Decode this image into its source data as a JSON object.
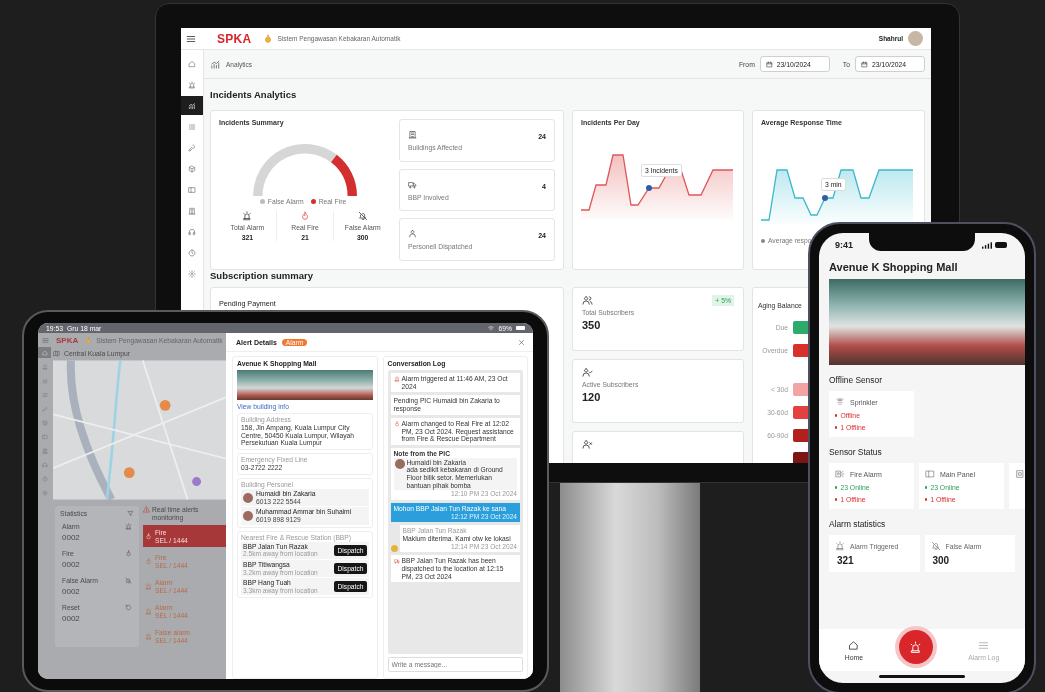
{
  "monitor": {
    "app_name": "SPKA",
    "system_name": "Sistem Pengawasan Kebakaran Automatik",
    "user": "Shahrul",
    "sidebar": [
      {
        "kind": "house",
        "selected": false
      },
      {
        "kind": "siren",
        "selected": false
      },
      {
        "kind": "chart",
        "selected": true
      },
      {
        "kind": "list",
        "selected": false
      },
      {
        "kind": "key",
        "selected": false
      },
      {
        "kind": "box",
        "selected": false
      },
      {
        "kind": "panel",
        "selected": false
      },
      {
        "kind": "building",
        "selected": false
      },
      {
        "kind": "headset",
        "selected": false
      },
      {
        "kind": "clock",
        "selected": false
      },
      {
        "kind": "gear",
        "selected": false
      }
    ],
    "page": "Analytics",
    "from_label": "From",
    "from_date": "23/10/2024",
    "to_label": "To",
    "to_date": "23/10/2024",
    "incidents_title": "Incidents Analytics",
    "incidents_summary": {
      "title": "Incidents Summary",
      "gauge": {
        "level": 0.25
      },
      "legend": [
        {
          "label": "False Alarm",
          "color": "#bdbdbd"
        },
        {
          "label": "Real Fire",
          "color": "#d32f2f"
        }
      ],
      "stats": [
        {
          "kind": "siren",
          "label": "Total Alarm",
          "value": "321"
        },
        {
          "kind": "flame",
          "label": "Real Fire",
          "value": "21"
        },
        {
          "kind": "bell-off",
          "label": "False Alarm",
          "value": "300"
        }
      ]
    },
    "stat_cards": [
      {
        "kind": "building",
        "label": "Buildings Affected",
        "value": "24"
      },
      {
        "kind": "truck",
        "label": "BBP Involved",
        "value": "4"
      },
      {
        "kind": "person",
        "label": "Personell Dispatched",
        "value": "24"
      }
    ],
    "incidents_per_day": {
      "title": "Incidents Per Day",
      "tooltip": "3 Incidents"
    },
    "response_time": {
      "title": "Average Response Time",
      "tooltip": "3 min",
      "legend": "Average respo"
    },
    "subscription_title": "Subscription summary",
    "pending_payment": {
      "title": "Pending Payment"
    },
    "subscribers": [
      {
        "kind": "users",
        "label": "Total Subscribers",
        "value": "350",
        "badge": "+ 5%"
      },
      {
        "kind": "user-check",
        "label": "Active Subscribers",
        "value": "120"
      },
      {
        "kind": "user-x"
      }
    ],
    "aging": {
      "title": "Aging Balance",
      "bars": [
        {
          "label": "Due",
          "color": "#2eaa6a"
        },
        {
          "label": "Overdue",
          "color": "#d9302c"
        },
        {
          "label": "< 30d",
          "color": "#f2a3a3"
        },
        {
          "label": "30-60d",
          "color": "#e2413f"
        },
        {
          "label": "60-90d",
          "color": "#b21f1f"
        },
        {
          "color": "#7d1515"
        }
      ]
    }
  },
  "tablet": {
    "time": "19:53",
    "date": "Gru 18 mar",
    "battery": "69%",
    "app_name": "SPKA",
    "system_name": "Sistem Pengawasan Kebakaran Automatik",
    "location": "Central Kuala Lumpur",
    "sidebar": [
      {
        "kind": "house",
        "selected": true
      },
      {
        "kind": "siren",
        "selected": false
      },
      {
        "kind": "chart",
        "selected": false
      },
      {
        "kind": "list",
        "selected": false
      },
      {
        "kind": "key",
        "selected": false
      },
      {
        "kind": "box",
        "selected": false
      },
      {
        "kind": "panel",
        "selected": false
      },
      {
        "kind": "building",
        "selected": false
      },
      {
        "kind": "headset",
        "selected": false
      },
      {
        "kind": "clock",
        "selected": false
      },
      {
        "kind": "gear",
        "selected": false
      }
    ],
    "statistics": {
      "title": "Statistics",
      "items": [
        {
          "kind": "siren",
          "label": "Alarm",
          "value": "0002"
        },
        {
          "kind": "flame",
          "label": "Fire",
          "value": "0002"
        },
        {
          "kind": "bell-off",
          "label": "False Alarm",
          "value": "0002"
        },
        {
          "kind": "reset",
          "label": "Reset",
          "value": "0002"
        }
      ]
    },
    "alerts": {
      "title": "Real time alerts monitoring",
      "rows": [
        {
          "kind": "flame",
          "type": "Fire",
          "code": "SEL / 1444",
          "selected": true
        },
        {
          "kind": "flame",
          "type": "Fire",
          "code": "SEL / 1444",
          "selected": false
        },
        {
          "kind": "siren",
          "type": "Alarm",
          "code": "SEL / 1444",
          "selected": false
        },
        {
          "kind": "siren",
          "type": "Alarm",
          "code": "SEL / 1444",
          "selected": false
        },
        {
          "kind": "siren",
          "type": "False alarm",
          "code": "SEL / 1444",
          "selected": false
        }
      ]
    },
    "alert_details": {
      "title": "Alert Details",
      "badge": "Alarm",
      "building": "Avenue K Shopping Mall",
      "link": "View building info",
      "address_label": "Building Address",
      "address": "158, Jln Ampang, Kuala Lumpur City Centre, 50450 Kuala Lumpur, Wilayah Persekutuan Kuala Lumpur",
      "phone_label": "Emergency Fixed Line",
      "phone": "03-2722 2222",
      "personnel_label": "Building Personel",
      "personnel": [
        {
          "name": "Humaidi bin Zakaria",
          "phone": "6013 222 5544"
        },
        {
          "name": "Muhammad Ammar bin Suhaimi",
          "phone": "6019 898 9129"
        }
      ],
      "stations_label": "Nearest Fire & Rescue Station (BBP)",
      "stations": [
        {
          "name": "BBP Jalan Tun Razak",
          "distance": "2.5km away from location",
          "action": "Dispatch"
        },
        {
          "name": "BBP Titiwangsa",
          "distance": "3.2km away from location",
          "action": "Dispatch"
        },
        {
          "name": "BBP Hang Tuah",
          "distance": "3.3km away from location",
          "action": "Dispatch"
        }
      ],
      "log_title": "Conversation Log",
      "log": [
        {
          "kind": "alarm-event",
          "text": "Alarm triggered at 11:46 AM, 23 Oct 2024"
        },
        {
          "kind": "event",
          "text": "Pending PIC Humaidi bin Zakaria to response"
        },
        {
          "kind": "fire-event",
          "text": "Alarm changed to Real Fire at 12:02 PM, 23 Oct 2024. Request assistance from Fire & Rescue Department"
        },
        {
          "kind": "note",
          "title": "Note from the PIC",
          "author": "Humaidi bin Zakaria",
          "text": "ada sedikit kebakaran di Ground Floor bilik setor. Memerlukan bantuan pihak bomba",
          "time": "12:10 PM 23 Oct 2024"
        },
        {
          "kind": "outgoing",
          "text": "Mohon BBP Jalan Tun Razak ke sana",
          "time": "12:12 PM 23 Oct 2024"
        },
        {
          "kind": "incoming",
          "author": "BBP Jalan Tun Razak",
          "text": "Maklum diterima. Kami otw ke lokasi",
          "time": "12:14 PM 23 Oct 2024"
        },
        {
          "kind": "dispatch-event",
          "text": "BBP Jalan Tun Razak has been dispatched to the location at 12:15 PM, 23 Oct 2024"
        }
      ],
      "message_placeholder": "Write a message..."
    }
  },
  "phone": {
    "time": "9:41",
    "title": "Avenue K Shopping Mall",
    "offline_title": "Offline Sensor",
    "offline": [
      {
        "kind": "sprinkler",
        "name": "Sprinkler",
        "lines": [
          {
            "text": "Offline",
            "online": false
          },
          {
            "text": "1 Offline",
            "online": false
          }
        ]
      }
    ],
    "status_title": "Sensor Status",
    "sensors": [
      {
        "kind": "fire-alarm",
        "name": "Fire Alarm",
        "lines": [
          {
            "text": "23 Online",
            "online": true
          },
          {
            "text": "1 Offline",
            "online": false
          }
        ]
      },
      {
        "kind": "panel",
        "name": "Main Panel",
        "lines": [
          {
            "text": "23 Online",
            "online": true
          },
          {
            "text": "1 Offline",
            "online": false
          }
        ]
      },
      {
        "kind": "device"
      }
    ],
    "stats_title": "Alarm statistics",
    "stats": [
      {
        "kind": "siren",
        "label": "Alarm Triggered",
        "value": "321"
      },
      {
        "kind": "bell-off",
        "label": "False Alarm",
        "value": "300"
      }
    ],
    "nav": [
      {
        "kind": "house",
        "label": "Home",
        "selected": true
      },
      {
        "kind": "alarm-button"
      },
      {
        "kind": "menu",
        "label": "Alarm Log",
        "selected": false
      }
    ]
  }
}
